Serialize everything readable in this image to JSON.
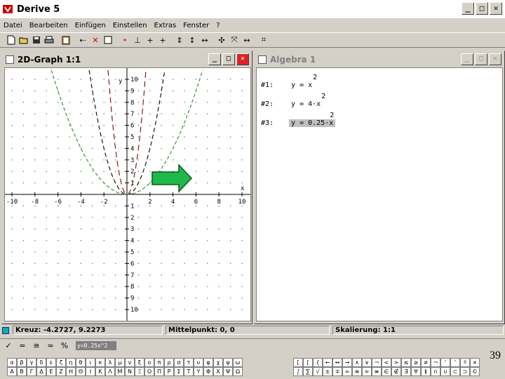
{
  "app": {
    "title": "Derive 5"
  },
  "window_buttons": {
    "minimize": "_",
    "maximize": "□",
    "close": "✕"
  },
  "menu": [
    "Datei",
    "Bearbeiten",
    "Einfügen",
    "Einstellen",
    "Extras",
    "Fenster",
    "?"
  ],
  "graph_window": {
    "title": "2D-Graph 1:1"
  },
  "algebra_window": {
    "title": "Algebra 1"
  },
  "algebra": {
    "expressions": [
      {
        "label": "#1:",
        "body": "y = x",
        "exp": "2",
        "selected": false
      },
      {
        "label": "#2:",
        "body": "y = 4·x",
        "exp": "2",
        "selected": false
      },
      {
        "label": "#3:",
        "body": "y = 0.25·x",
        "exp": "2",
        "selected": true
      }
    ]
  },
  "chart_data": {
    "type": "line",
    "title": "",
    "xlabel": "x",
    "ylabel": "y",
    "xlim": [
      -10,
      10
    ],
    "ylim": [
      -10,
      10
    ],
    "x_ticks": [
      "-10",
      "-8",
      "-6",
      "-4",
      "-2",
      "2",
      "4",
      "6",
      "8",
      "10"
    ],
    "y_ticks": [
      "10",
      "9",
      "8",
      "7",
      "6",
      "5",
      "4",
      "3",
      "2",
      "1",
      "1",
      "2",
      "3",
      "4",
      "5",
      "6",
      "7",
      "8",
      "9",
      "10"
    ],
    "grid": "dots",
    "series": [
      {
        "expr": "y = x^2",
        "coef": 1,
        "color": "#000000",
        "dash": "6,4"
      },
      {
        "expr": "y = 4x^2",
        "coef": 4,
        "color": "#8b0000",
        "dash": "8,5"
      },
      {
        "expr": "y = 0.25x^2",
        "coef": 0.25,
        "color": "#2e8b2e",
        "dash": "5,3"
      }
    ]
  },
  "status": {
    "kreuz": "Kreuz: -4.2727, 9.2273",
    "mittelpunkt": "Mittelpunkt: 0, 0",
    "skalierung": "Skalierung: 1:1"
  },
  "input": {
    "buttons": [
      "✓",
      "=",
      "≅",
      "≈",
      "%"
    ],
    "value": "y=0.25x^2"
  },
  "palette_greek": {
    "row1": [
      "α",
      "β",
      "γ",
      "δ",
      "ε",
      "ζ",
      "η",
      "θ",
      "ι",
      "κ",
      "λ",
      "μ",
      "ν",
      "ξ",
      "ο",
      "π",
      "ρ",
      "σ",
      "τ",
      "υ",
      "φ",
      "χ",
      "ψ",
      "ω"
    ],
    "row2": [
      "Α",
      "Β",
      "Γ",
      "Δ",
      "Ε",
      "Ζ",
      "Η",
      "Θ",
      "Ι",
      "Κ",
      "Λ",
      "Μ",
      "Ν",
      "Ξ",
      "Ο",
      "Π",
      "Ρ",
      "Σ",
      "Τ",
      "Υ",
      "Φ",
      "Χ",
      "Ψ",
      "Ω"
    ]
  },
  "palette_math": {
    "row1": [
      "[",
      "[",
      "{",
      "←",
      "↔",
      "→",
      "∧",
      "∨",
      "¬",
      "<",
      ">",
      "≤",
      "≥",
      "≠",
      "¬",
      "'",
      "‘",
      "º",
      "×"
    ],
    "row2": [
      "∫",
      "∑",
      "√",
      "±",
      "∓",
      "∞",
      "≅",
      "≈",
      "≡",
      "∈",
      "∉",
      "∃",
      "∀",
      "≬",
      "∩",
      "∪",
      "⊂",
      "⊃",
      "©"
    ]
  },
  "page_number": "39"
}
